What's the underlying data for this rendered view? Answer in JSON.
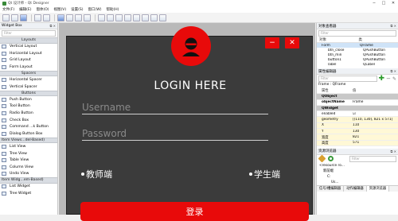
{
  "window": {
    "title": "Qt 设计师 - Qt Designer"
  },
  "menu": [
    "文件(F)",
    "编辑(E)",
    "窗体(O)",
    "视图(V)",
    "设置(S)",
    "窗口(W)",
    "帮助(H)"
  ],
  "widget_box": {
    "title": "Widget Box",
    "filter_placeholder": "Filter",
    "sections": [
      {
        "header": "Layouts",
        "align": "center",
        "items": [
          "Vertical Layout",
          "Horizontal Layout",
          "Grid Layout",
          "Form Layout"
        ]
      },
      {
        "header": "Spacers",
        "align": "center",
        "items": [
          "Horizontal Spacer",
          "Vertical Spacer"
        ]
      },
      {
        "header": "Buttons",
        "align": "center",
        "items": [
          "Push Button",
          "Tool Button",
          "Radio Button",
          "Check Box",
          "Command ...k Button",
          "Dialog Button Box"
        ]
      },
      {
        "header": "Item Views...del-Based)",
        "align": "left",
        "items": [
          "List View",
          "Tree View",
          "Table View",
          "Column View",
          "Undo View"
        ]
      },
      {
        "header": "Item Widg...em-Based)",
        "align": "left",
        "items": [
          "List Widget",
          "Tree Widget"
        ]
      }
    ]
  },
  "form": {
    "title": "LOGIN HERE",
    "minimize_label": "−",
    "close_label": "✕",
    "username_placeholder": "Username",
    "password_placeholder": "Password",
    "radio_teacher": "教师端",
    "radio_student": "学生端",
    "login_button": "登录"
  },
  "object_inspector": {
    "title": "对象查看器",
    "filter_placeholder": "Filter",
    "columns": [
      "对象",
      "类"
    ],
    "rows": [
      {
        "object": "Form",
        "class": "QFrame",
        "selected": true
      },
      {
        "object": "btn_close",
        "class": "QPushButton",
        "selected": false
      },
      {
        "object": "btn_min",
        "class": "QPushButton",
        "selected": false
      },
      {
        "object": "button1",
        "class": "QPushButton",
        "selected": false
      },
      {
        "object": "label",
        "class": "QLabel",
        "selected": false
      }
    ]
  },
  "property_editor": {
    "title": "属性编辑器",
    "filter_placeholder": "Filter",
    "context": "Frame : QFrame",
    "columns": [
      "属性",
      "值"
    ],
    "rows": [
      {
        "key": "QObject",
        "value": "",
        "type": "grp"
      },
      {
        "key": "objectName",
        "value": "Frame",
        "type": "bold"
      },
      {
        "key": "QWidget",
        "value": "",
        "type": "grp"
      },
      {
        "key": "enabled",
        "value": "☑",
        "type": ""
      },
      {
        "key": "geometry",
        "value": "[(110, 130), 821 x 571]",
        "type": "yellow"
      },
      {
        "key": "X",
        "value": "110",
        "type": "yellow"
      },
      {
        "key": "Y",
        "value": "130",
        "type": "yellow"
      },
      {
        "key": "宽度",
        "value": "821",
        "type": "yellow"
      },
      {
        "key": "高度",
        "value": "571",
        "type": "yellow"
      }
    ]
  },
  "resource_browser": {
    "title": "资源浏览器",
    "filter_placeholder": "Filter",
    "tree": [
      "<resource ro...",
      "新前缀",
      "C:",
      "Us..."
    ],
    "tabs": [
      "信号/槽编辑器",
      "动作编辑器",
      "资源浏览器"
    ]
  }
}
